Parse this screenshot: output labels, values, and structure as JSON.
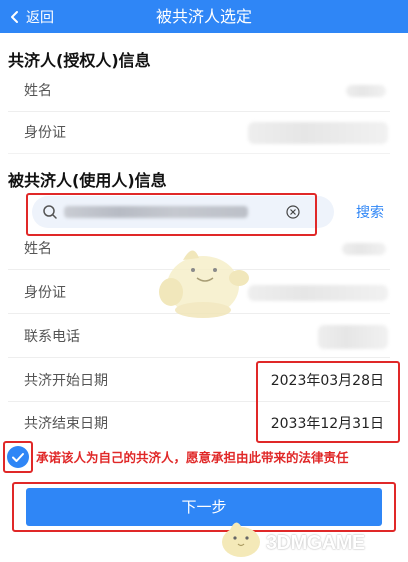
{
  "header": {
    "back_label": "返回",
    "title": "被共济人选定"
  },
  "authorizer": {
    "section_title": "共济人(授权人)信息",
    "name_label": "姓名",
    "id_label": "身份证"
  },
  "user": {
    "section_title": "被共济人(使用人)信息",
    "name_label": "姓名",
    "id_label": "身份证",
    "phone_label": "联系电话",
    "start_label": "共济开始日期",
    "start_value": "2023年03月28日",
    "end_label": "共济结束日期",
    "end_value": "2033年12月31日"
  },
  "search": {
    "placeholder": "",
    "button_label": "搜索"
  },
  "commitment": {
    "text": "承诺该人为自己的共济人，愿意承担由此带来的法律责任",
    "checked": true
  },
  "next_button_label": "下一步",
  "watermark": {
    "text": "3DMGAME"
  },
  "colors": {
    "primary": "#2f86f6",
    "highlight": "#e02828"
  }
}
